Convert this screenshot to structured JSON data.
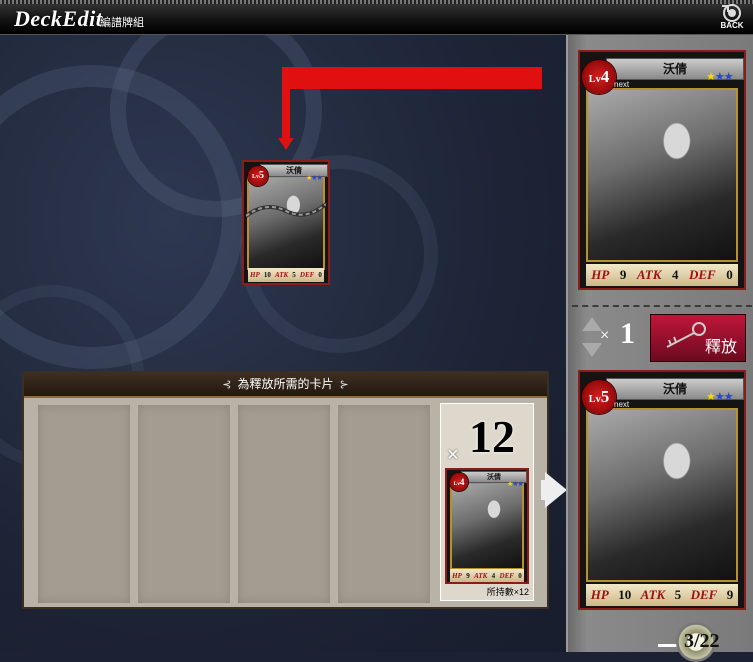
{
  "header": {
    "title": "DeckEdit",
    "subtitle": "編譜牌組",
    "back_label": "BACK"
  },
  "selected_card": {
    "level_prefix": "Lv",
    "level": "5",
    "name": "沃倩",
    "stars": {
      "gold": 1,
      "blue": 2
    },
    "stats": {
      "hp_label": "HP",
      "hp": "10",
      "atk_label": "ATK",
      "atk": "5",
      "def_label": "DEF",
      "def": "0"
    }
  },
  "release_panel": {
    "header": "為釋放所需的卡片",
    "stack_count": "12",
    "stack_times": "×",
    "owned_label": "所持數×12",
    "card": {
      "level_prefix": "Lv",
      "level": "4",
      "name": "沃倩",
      "stats": {
        "hp_label": "HP",
        "hp": "9",
        "atk_label": "ATK",
        "atk": "4",
        "def_label": "DEF",
        "def": "0"
      }
    }
  },
  "sidebar": {
    "top_card": {
      "level_prefix": "Lv",
      "level": "4",
      "name": "沃倩",
      "next_label": "next",
      "stars": {
        "gold": 1,
        "blue": 2
      },
      "stats": {
        "hp_label": "HP",
        "hp": "9",
        "atk_label": "ATK",
        "atk": "4",
        "def_label": "DEF",
        "def": "0"
      }
    },
    "release_count_times": "×",
    "release_count": "1",
    "release_button": "釋放",
    "bottom_card": {
      "level_prefix": "Lv",
      "level": "5",
      "name": "沃倩",
      "next_label": "next",
      "stars": {
        "gold": 1,
        "blue": 2
      },
      "stats": {
        "hp_label": "HP",
        "hp": "10",
        "atk_label": "ATK",
        "atk": "5",
        "def_label": "DEF",
        "def": "9"
      }
    }
  },
  "footer": {
    "card_count": "3/22"
  },
  "colors": {
    "arrow": "#e01010",
    "release_button": "#c0163b",
    "card_frame": "#8c1b1b"
  }
}
